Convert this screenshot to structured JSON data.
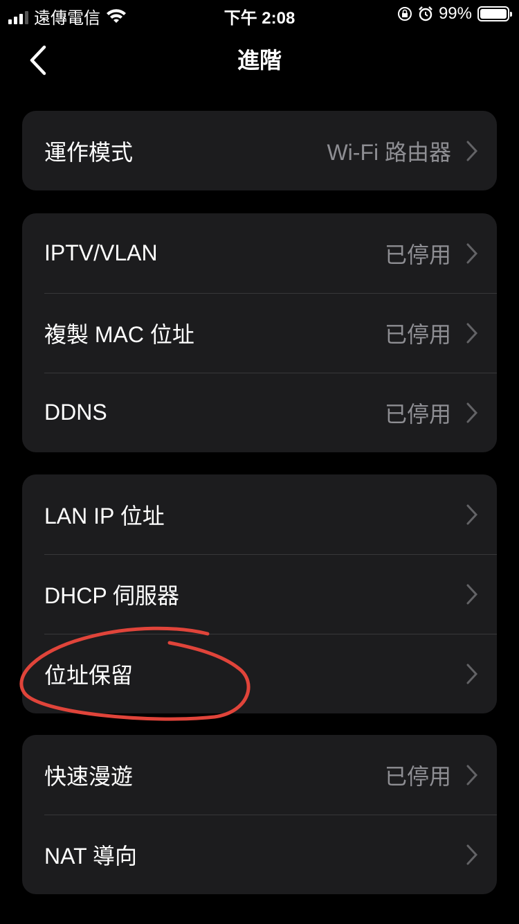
{
  "status_bar": {
    "carrier": "遠傳電信",
    "time": "下午 2:08",
    "battery_percent": "99%",
    "battery_level": 0.99
  },
  "nav": {
    "title": "進階"
  },
  "groups": [
    {
      "rows": [
        {
          "label": "運作模式",
          "value": "Wi-Fi 路由器"
        }
      ]
    },
    {
      "rows": [
        {
          "label": "IPTV/VLAN",
          "value": "已停用"
        },
        {
          "label": "複製 MAC 位址",
          "value": "已停用"
        },
        {
          "label": "DDNS",
          "value": "已停用"
        }
      ]
    },
    {
      "rows": [
        {
          "label": "LAN IP 位址",
          "value": ""
        },
        {
          "label": "DHCP 伺服器",
          "value": ""
        },
        {
          "label": "位址保留",
          "value": ""
        }
      ]
    },
    {
      "rows": [
        {
          "label": "快速漫遊",
          "value": "已停用"
        },
        {
          "label": "NAT 導向",
          "value": ""
        }
      ]
    }
  ],
  "colors": {
    "background": "#000000",
    "card": "#1c1c1e",
    "secondary_text": "#8e8e93",
    "annotation": "#e0443a"
  }
}
